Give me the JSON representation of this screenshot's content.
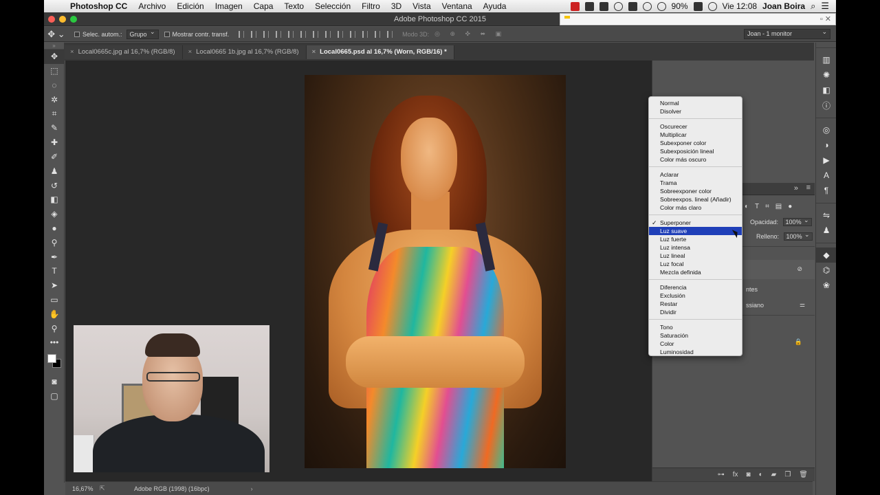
{
  "menubar": {
    "app_name": "Photoshop CC",
    "items": [
      "Archivo",
      "Edición",
      "Imagen",
      "Capa",
      "Texto",
      "Selección",
      "Filtro",
      "3D",
      "Vista",
      "Ventana",
      "Ayuda"
    ],
    "battery": "90%",
    "clock": "Vie 12:08",
    "user": "Joan Boira"
  },
  "window": {
    "title": "Adobe Photoshop CC 2015"
  },
  "options": {
    "auto_select_label": "Selec. autom.:",
    "auto_select_value": "Grupo",
    "show_transform_label": "Mostrar contr. transf.",
    "mode3d_label": "Modo 3D:",
    "workspace": "Joan - 1 monitor"
  },
  "tabs": [
    {
      "label": "Local0665c.jpg al 16,7% (RGB/8)"
    },
    {
      "label": "Local0665 1b.jpg al 16,7% (RGB/8)"
    },
    {
      "label": "Local0665.psd al 16,7% (Worn, RGB/16) *"
    }
  ],
  "status": {
    "zoom": "16,67%",
    "profile": "Adobe RGB (1998) (16bpc)",
    "arrow": "›"
  },
  "panel": {
    "opacity_label": "Opacidad:",
    "opacity_value": "100%",
    "fill_label": "Relleno:",
    "fill_value": "100%",
    "layer_fragment_1": "ntes",
    "layer_fragment_2": "ssiano"
  },
  "blend_modes": {
    "groups": [
      [
        "Normal",
        "Disolver"
      ],
      [
        "Oscurecer",
        "Multiplicar",
        "Subexponer color",
        "Subexposición lineal",
        "Color más oscuro"
      ],
      [
        "Aclarar",
        "Trama",
        "Sobreexponer color",
        "Sobreexpos. lineal (Añadir)",
        "Color más claro"
      ],
      [
        "Superponer",
        "Luz suave",
        "Luz fuerte",
        "Luz intensa",
        "Luz lineal",
        "Luz focal",
        "Mezcla definida"
      ],
      [
        "Diferencia",
        "Exclusión",
        "Restar",
        "Dividir"
      ],
      [
        "Tono",
        "Saturación",
        "Color",
        "Luminosidad"
      ]
    ],
    "checked": "Superponer",
    "highlighted": "Luz suave"
  },
  "colors": {
    "highlight": "#1f3fb8",
    "app_bg": "#535353",
    "canvas_bg": "#282828"
  }
}
